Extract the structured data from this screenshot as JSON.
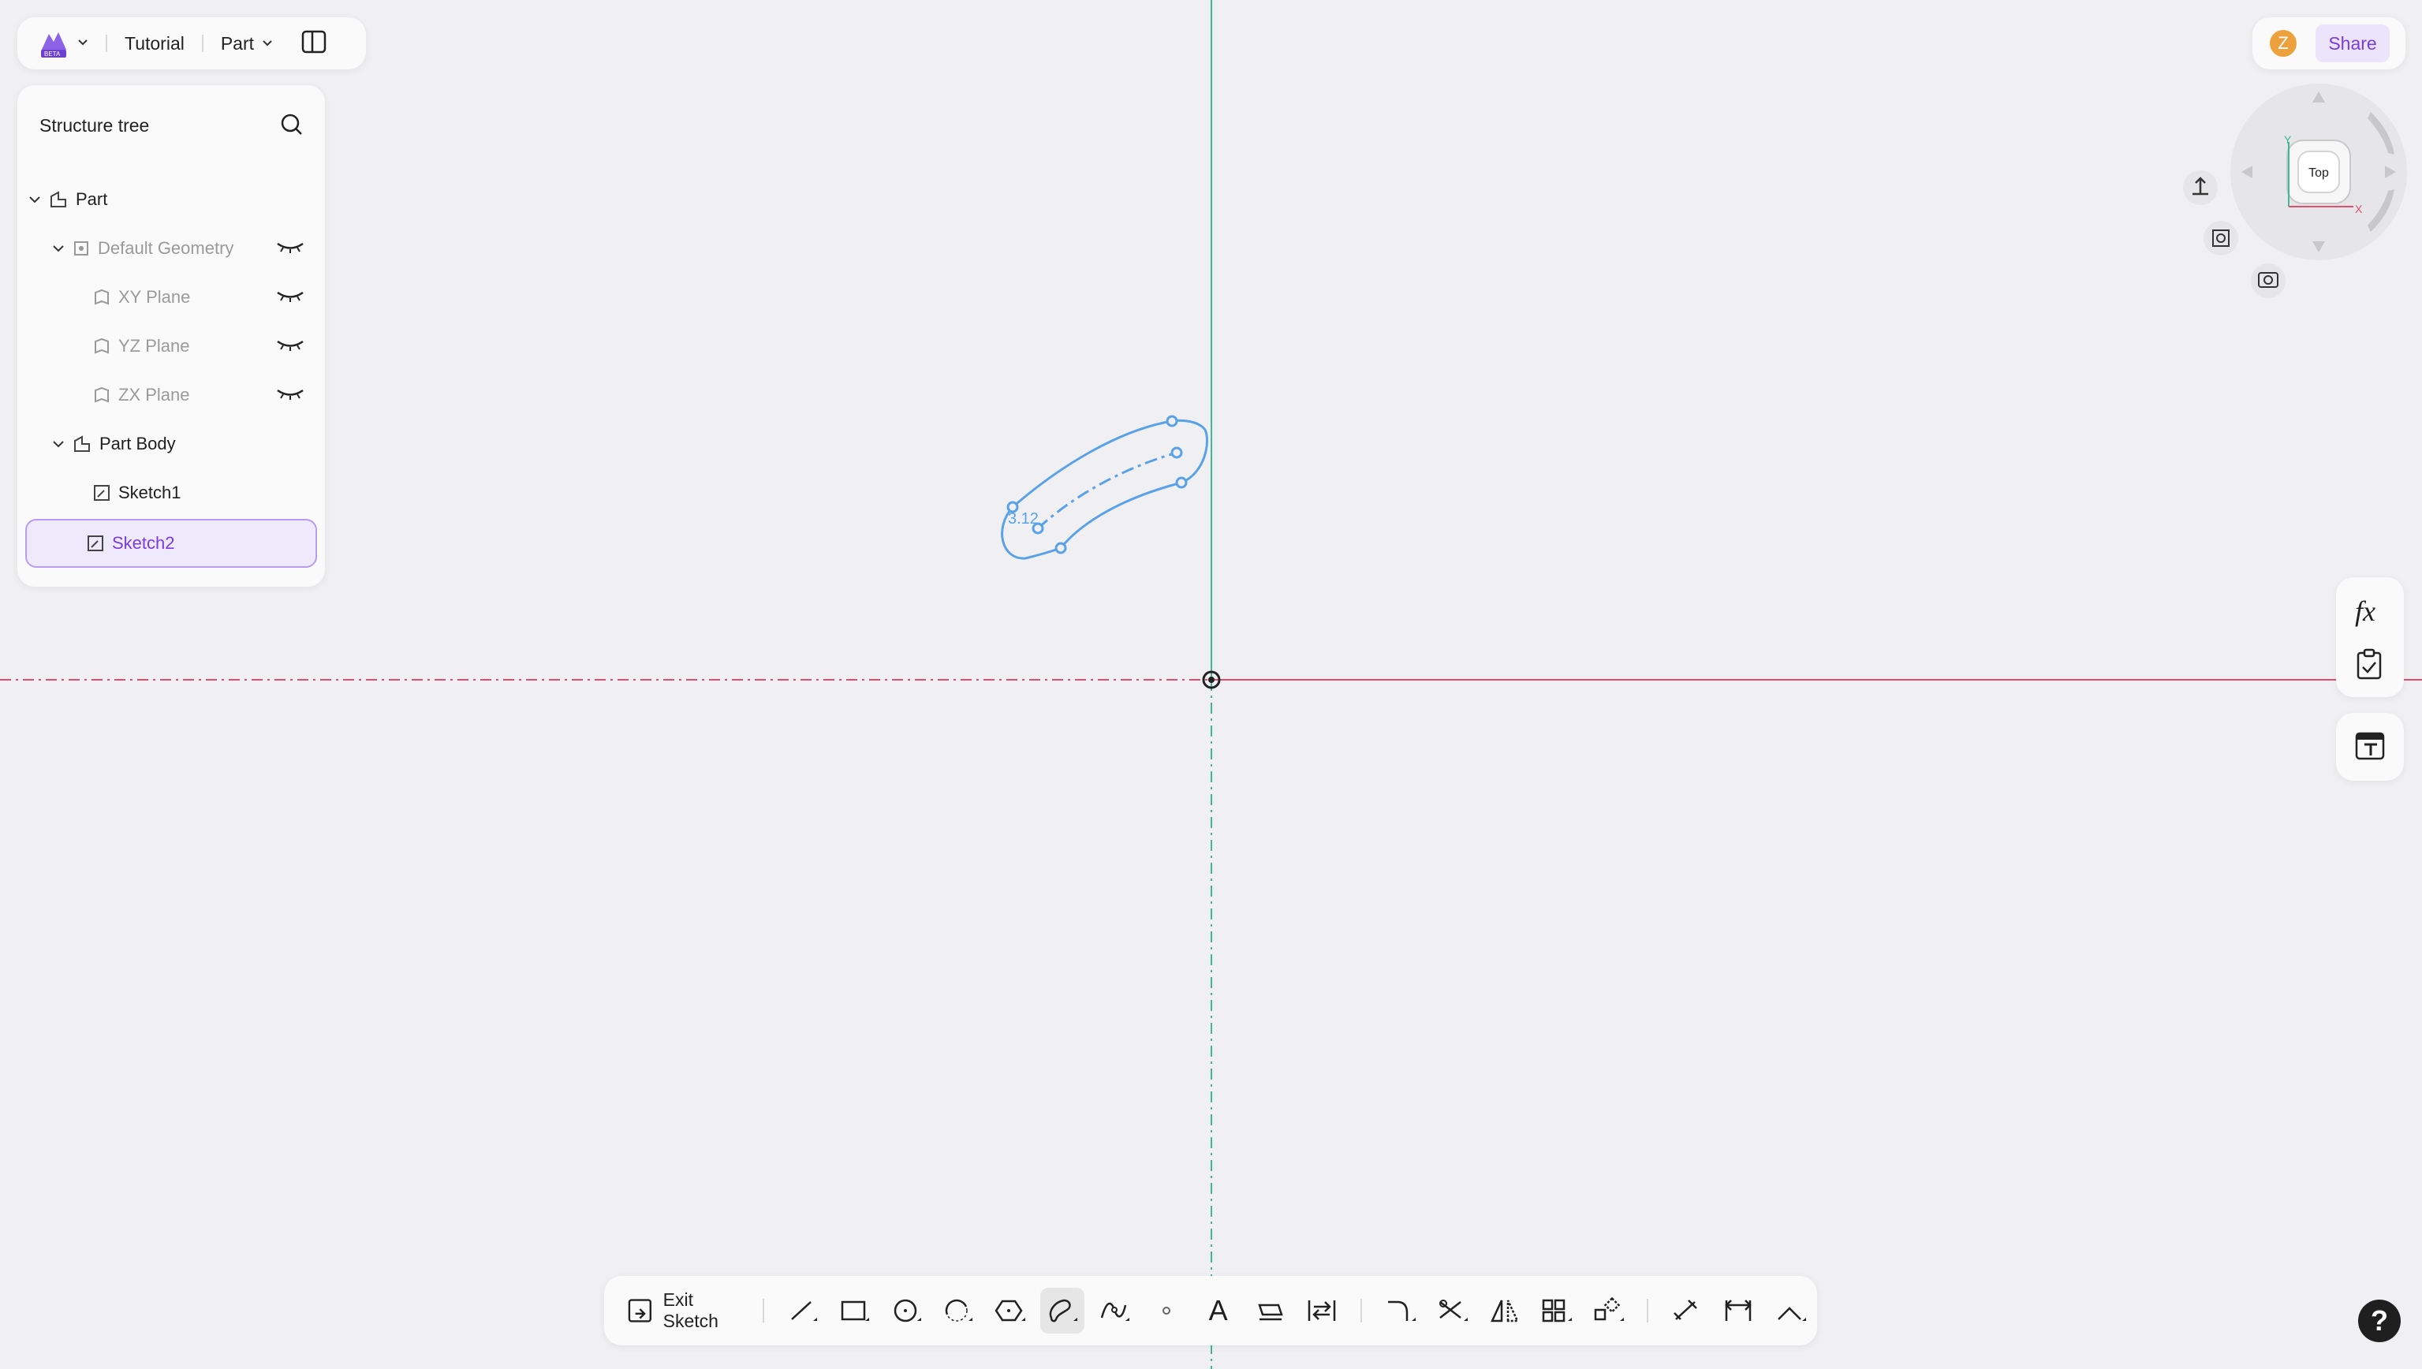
{
  "header": {
    "app_name": "Tutorial",
    "mode_label": "Part"
  },
  "tree": {
    "title": "Structure tree",
    "items": [
      {
        "label": "Part"
      },
      {
        "label": "Default Geometry"
      },
      {
        "label": "XY Plane"
      },
      {
        "label": "YZ Plane"
      },
      {
        "label": "ZX Plane"
      },
      {
        "label": "Part Body"
      },
      {
        "label": "Sketch1"
      },
      {
        "label": "Sketch2"
      }
    ]
  },
  "account": {
    "avatar_letter": "Z",
    "share_label": "Share"
  },
  "view_cube": {
    "face_label": "Top",
    "axis_x": "X",
    "axis_y": "Y"
  },
  "sketch": {
    "dimension_label": "3.12"
  },
  "side_tools": {
    "formula_label": "fx"
  },
  "toolbar": {
    "exit_label": "Exit Sketch",
    "text_tool_glyph": "A"
  },
  "help": {
    "label": "?"
  },
  "colors": {
    "accent": "#7a3ce0",
    "sketch": "#5aa2e8",
    "x_axis": "#e0506e",
    "y_axis": "#3fb898"
  }
}
